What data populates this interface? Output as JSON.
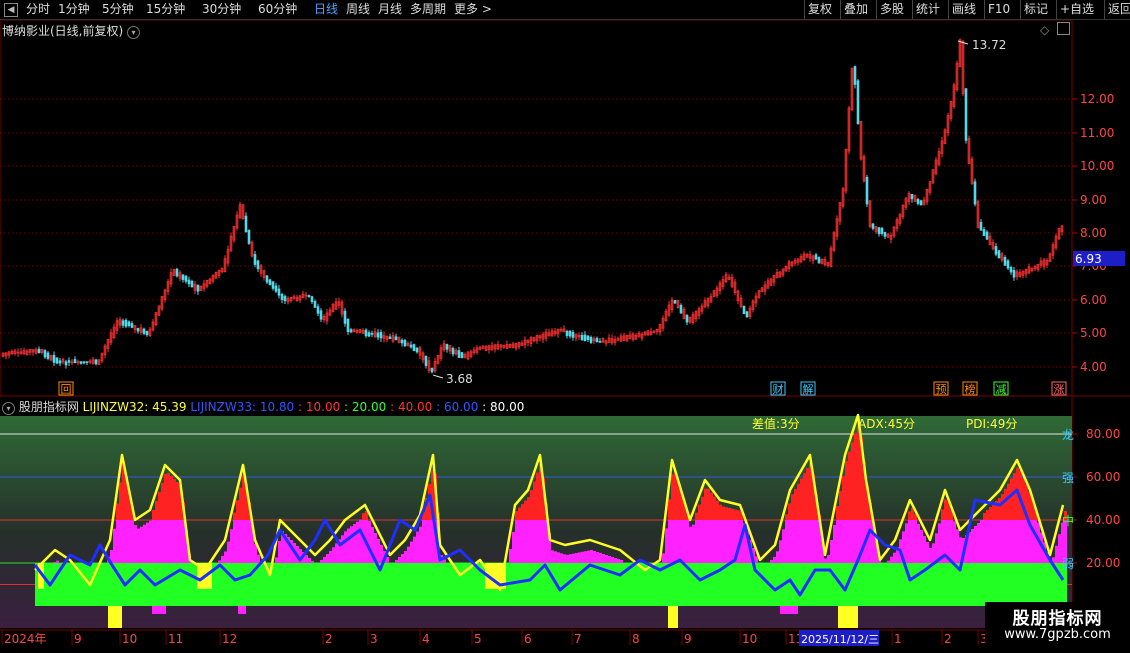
{
  "toolbar": {
    "left_items": [
      "分时",
      "1分钟",
      "5分钟",
      "15分钟",
      "30分钟",
      "60分钟",
      "日线",
      "周线",
      "月线",
      "多周期",
      "更多 >"
    ],
    "active_item": "日线",
    "right_items": [
      "复权",
      "叠加",
      "多股",
      "统计",
      "画线",
      "F10",
      "标记",
      "+自选",
      "返回"
    ]
  },
  "main": {
    "title": "博纳影业(日线,前复权)",
    "price_axis": [
      "12.00",
      "11.00",
      "10.00",
      "9.00",
      "8.00",
      "7.00",
      "6.00",
      "5.00",
      "4.00"
    ],
    "current_price": "6.93",
    "high_label": "13.72",
    "low_label": "3.68",
    "markers": [
      {
        "text": "回",
        "color": "#ff8c00"
      },
      {
        "text": "财",
        "color": "#33ccff"
      },
      {
        "text": "解",
        "color": "#33ccff"
      },
      {
        "text": "预",
        "color": "#ff8c00"
      },
      {
        "text": "榜",
        "color": "#ff8c00"
      },
      {
        "text": "减",
        "color": "#33ff33"
      },
      {
        "text": "涨",
        "color": "#ff6666"
      }
    ]
  },
  "indicator": {
    "name": "股朋指标网",
    "params": [
      {
        "text": "LIJINZW32: 45.39",
        "color": "#ffff33"
      },
      {
        "text": "LIJINZW33: 10.80",
        "color": "#3355ff"
      },
      {
        "text": ": 10.00",
        "color": "#ff3333"
      },
      {
        "text": ": 20.00",
        "color": "#33ff33"
      },
      {
        "text": ": 40.00",
        "color": "#ff3333"
      },
      {
        "text": ": 60.00",
        "color": "#3355ff"
      },
      {
        "text": ": 80.00",
        "color": "#ffffff"
      }
    ],
    "labels": [
      {
        "text": "差值:3分",
        "color": "#ffff33"
      },
      {
        "text": "ADX:45分",
        "color": "#ffff33"
      },
      {
        "text": "PDI:49分",
        "color": "#ffff33"
      }
    ],
    "axis": [
      "80.00",
      "60.00",
      "40.00",
      "20.00"
    ],
    "side_labels": [
      {
        "text": "龙",
        "color": "#33ccff"
      },
      {
        "text": "强",
        "color": "#33ccff"
      },
      {
        "text": "中",
        "color": "#33ff33"
      },
      {
        "text": "弱",
        "color": "#33ccff"
      }
    ]
  },
  "date_axis": [
    "2024年",
    "9",
    "10",
    "11",
    "12",
    "2",
    "3",
    "4",
    "5",
    "6",
    "7",
    "8",
    "9",
    "10",
    "11",
    "1",
    "2",
    "3"
  ],
  "date_cursor": "2025/11/12/三",
  "logo": {
    "line1": "股朋指标网",
    "line2": "www.7gpzb.com"
  }
}
